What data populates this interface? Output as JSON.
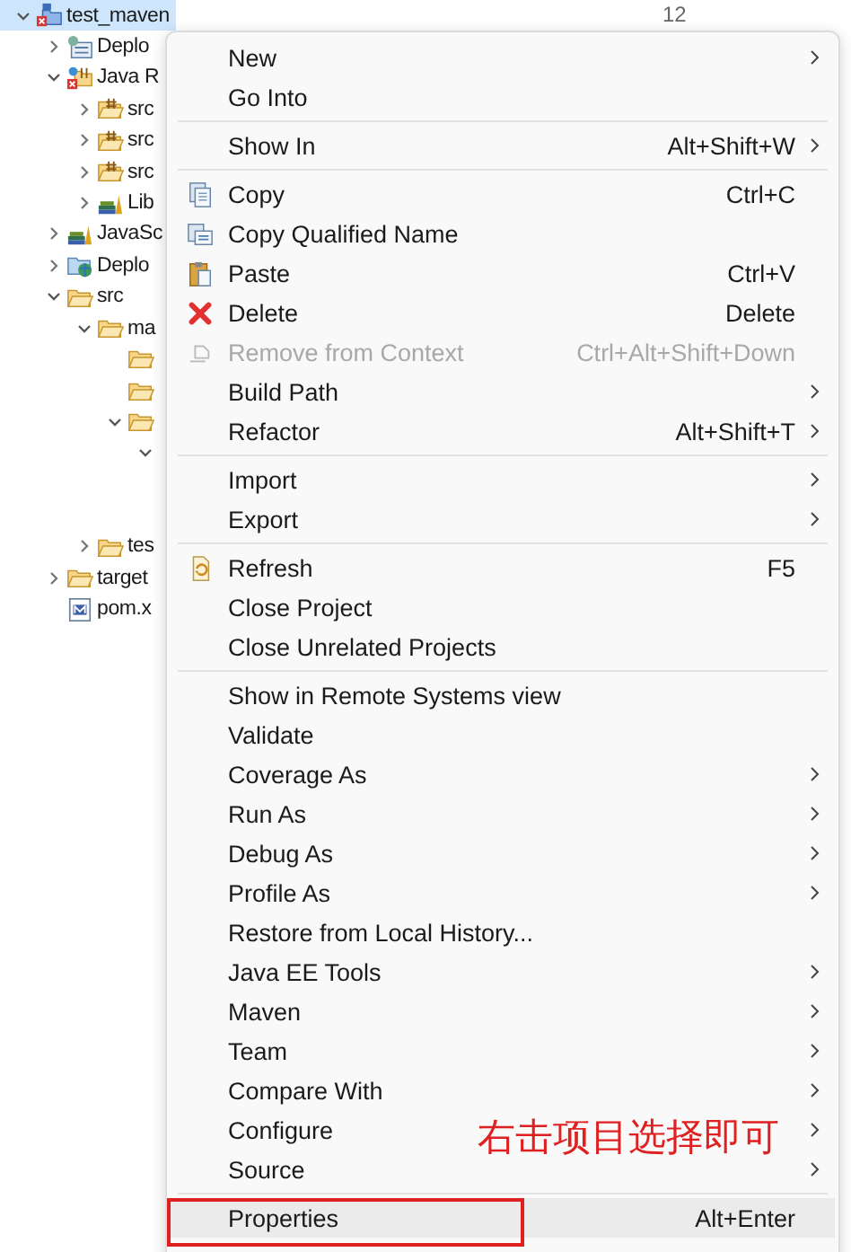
{
  "tree": [
    {
      "label": "test_maven",
      "kind": "project",
      "expanded": true,
      "selected": true,
      "children": [
        {
          "label": "Deplo",
          "kind": "deploy",
          "expanded": false,
          "selected": false
        },
        {
          "label": "Java R",
          "kind": "java-resources",
          "expanded": true,
          "selected": false,
          "children": [
            {
              "label": "src",
              "kind": "package",
              "expanded": false,
              "selected": false
            },
            {
              "label": "src",
              "kind": "package",
              "expanded": false,
              "selected": false
            },
            {
              "label": "src",
              "kind": "package",
              "expanded": false,
              "selected": false
            },
            {
              "label": "Lib",
              "kind": "library",
              "expanded": false,
              "selected": false
            }
          ]
        },
        {
          "label": "JavaSc",
          "kind": "library",
          "expanded": false,
          "selected": false
        },
        {
          "label": "Deplo",
          "kind": "web",
          "expanded": false,
          "selected": false
        },
        {
          "label": "src",
          "kind": "folder",
          "expanded": true,
          "selected": false,
          "children": [
            {
              "label": "ma",
              "kind": "folder",
              "expanded": true,
              "selected": false,
              "children": [
                {
                  "kind": "folder",
                  "selected": false
                },
                {
                  "kind": "folder",
                  "selected": false
                },
                {
                  "kind": "folder",
                  "expanded": true,
                  "selected": false,
                  "children": [
                    {
                      "expanded": true,
                      "selected": false
                    }
                  ]
                }
              ]
            },
            {
              "label": "tes",
              "kind": "folder",
              "expanded": false,
              "selected": false
            }
          ]
        },
        {
          "label": "target",
          "kind": "folder",
          "expanded": false,
          "selected": false
        },
        {
          "label": "pom.x",
          "kind": "maven-file",
          "selected": false
        }
      ]
    }
  ],
  "editor": {
    "line_number": "12"
  },
  "menu": {
    "groups": [
      [
        {
          "label": "New",
          "submenu": true,
          "disabled": false,
          "selected": false
        },
        {
          "label": "Go Into",
          "submenu": false,
          "disabled": false,
          "selected": false
        }
      ],
      [
        {
          "label": "Show In",
          "shortcut": "Alt+Shift+W",
          "submenu": true,
          "disabled": false,
          "selected": false
        }
      ],
      [
        {
          "label": "Copy",
          "shortcut": "Ctrl+C",
          "kind": "copy",
          "submenu": false,
          "disabled": false,
          "selected": false
        },
        {
          "label": "Copy Qualified Name",
          "kind": "copy-name",
          "submenu": false,
          "disabled": false,
          "selected": false
        },
        {
          "label": "Paste",
          "shortcut": "Ctrl+V",
          "kind": "paste",
          "submenu": false,
          "disabled": false,
          "selected": false
        },
        {
          "label": "Delete",
          "shortcut": "Delete",
          "kind": "delete",
          "submenu": false,
          "disabled": false,
          "selected": false
        },
        {
          "label": "Remove from Context",
          "shortcut": "Ctrl+Alt+Shift+Down",
          "kind": "remove",
          "submenu": false,
          "disabled": true,
          "selected": false
        },
        {
          "label": "Build Path",
          "submenu": true,
          "disabled": false,
          "selected": false
        },
        {
          "label": "Refactor",
          "shortcut": "Alt+Shift+T",
          "submenu": true,
          "disabled": false,
          "selected": false
        }
      ],
      [
        {
          "label": "Import",
          "submenu": true,
          "disabled": false,
          "selected": false
        },
        {
          "label": "Export",
          "submenu": true,
          "disabled": false,
          "selected": false
        }
      ],
      [
        {
          "label": "Refresh",
          "shortcut": "F5",
          "kind": "refresh",
          "submenu": false,
          "disabled": false,
          "selected": false
        },
        {
          "label": "Close Project",
          "submenu": false,
          "disabled": false,
          "selected": false
        },
        {
          "label": "Close Unrelated Projects",
          "submenu": false,
          "disabled": false,
          "selected": false
        }
      ],
      [
        {
          "label": "Show in Remote Systems view",
          "submenu": false,
          "disabled": false,
          "selected": false
        },
        {
          "label": "Validate",
          "submenu": false,
          "disabled": false,
          "selected": false
        },
        {
          "label": "Coverage As",
          "submenu": true,
          "disabled": false,
          "selected": false
        },
        {
          "label": "Run As",
          "submenu": true,
          "disabled": false,
          "selected": false
        },
        {
          "label": "Debug As",
          "submenu": true,
          "disabled": false,
          "selected": false
        },
        {
          "label": "Profile As",
          "submenu": true,
          "disabled": false,
          "selected": false
        },
        {
          "label": "Restore from Local History...",
          "submenu": false,
          "disabled": false,
          "selected": false
        },
        {
          "label": "Java EE Tools",
          "submenu": true,
          "disabled": false,
          "selected": false
        },
        {
          "label": "Maven",
          "submenu": true,
          "disabled": false,
          "selected": false
        },
        {
          "label": "Team",
          "submenu": true,
          "disabled": false,
          "selected": false
        },
        {
          "label": "Compare With",
          "submenu": true,
          "disabled": false,
          "selected": false
        },
        {
          "label": "Configure",
          "submenu": true,
          "disabled": false,
          "selected": false
        },
        {
          "label": "Source",
          "submenu": true,
          "disabled": false,
          "selected": false
        }
      ],
      [
        {
          "label": "Properties",
          "shortcut": "Alt+Enter",
          "submenu": false,
          "disabled": false,
          "selected": true
        }
      ]
    ]
  },
  "annotation": {
    "text": "右击项目选择即可"
  }
}
